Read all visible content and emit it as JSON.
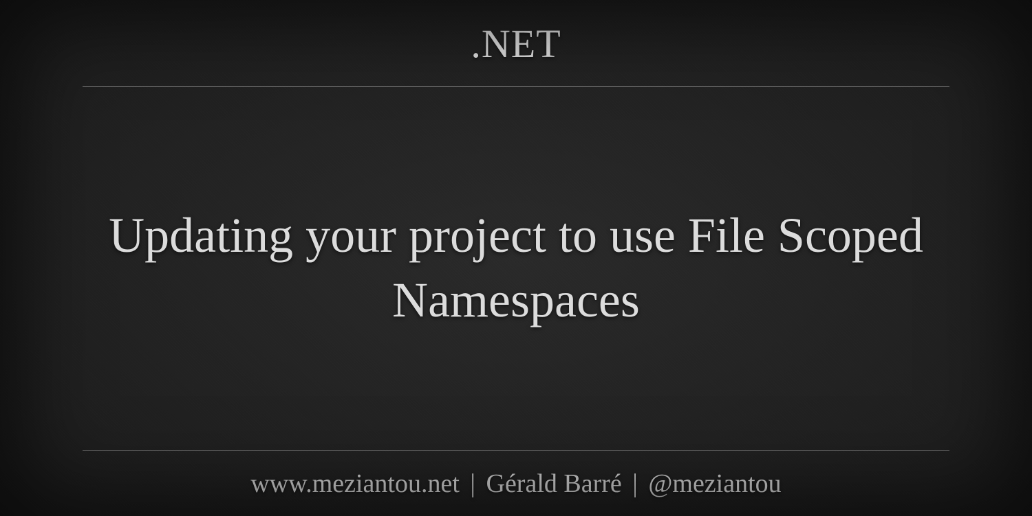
{
  "header": {
    "category": ".NET"
  },
  "main": {
    "title": "Updating your project to use File Scoped Namespaces"
  },
  "footer": {
    "website": "www.meziantou.net",
    "separator1": "|",
    "author": "Gérald Barré",
    "separator2": "|",
    "handle": "@meziantou"
  }
}
